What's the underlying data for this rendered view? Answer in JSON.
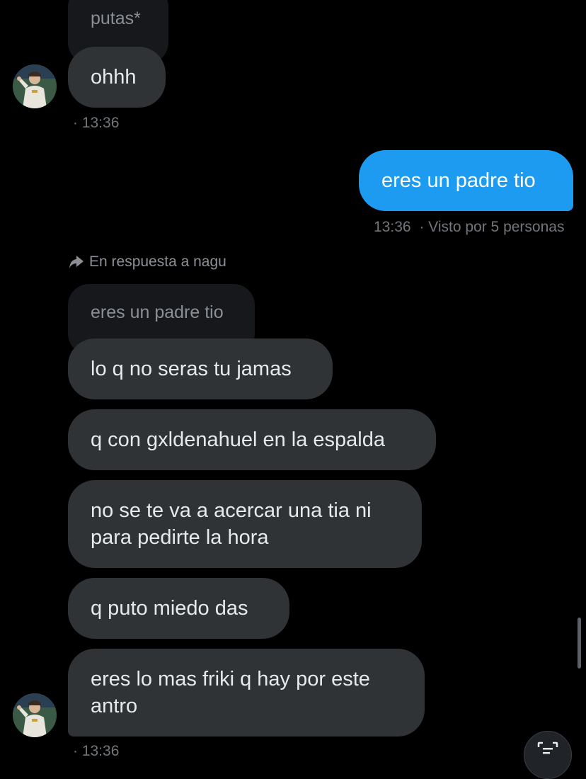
{
  "messages": {
    "quoted_1": "putas*",
    "reply_1": "ohhh",
    "timestamp_1": "· 13:36",
    "sent_1": "eres un padre tio",
    "sent_1_time": "13:36",
    "sent_1_seen": "· Visto por 5 personas",
    "reply_context": "En respuesta a nagu",
    "quoted_2": "eres un padre tio",
    "reply_2": "lo q no seras tu jamas",
    "reply_3": "q con gxldenahuel en la espalda",
    "reply_4_line1": "no se te va a acercar una tia ni",
    "reply_4_line2": "para pedirte la hora",
    "reply_5": "q puto miedo das",
    "reply_6_line1": "eres lo mas friki q hay por este",
    "reply_6_line2": "antro",
    "timestamp_2": "· 13:36"
  },
  "icons": {
    "reply_arrow": "reply-arrow-icon",
    "avatar": "avatar",
    "scan": "scan-text-icon"
  },
  "colors": {
    "background": "#000000",
    "received_bubble": "#2f3336",
    "quoted_bubble": "#16181c",
    "sent_bubble": "#1d9bf0",
    "meta_text": "#71767b"
  }
}
